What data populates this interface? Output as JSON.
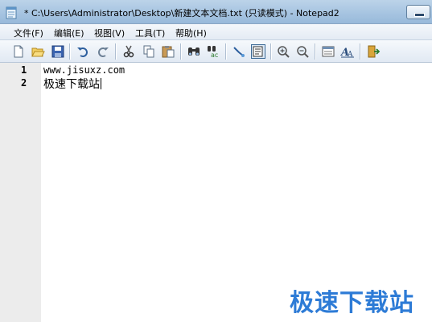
{
  "window": {
    "title": "* C:\\Users\\Administrator\\Desktop\\新建文本文档.txt (只读模式) - Notepad2"
  },
  "menu": {
    "items": [
      "文件(F)",
      "编辑(E)",
      "视图(V)",
      "工具(T)",
      "帮助(H)"
    ]
  },
  "toolbar": {
    "buttons": [
      "new-file-icon",
      "open-folder-icon",
      "save-icon",
      "undo-icon",
      "redo-icon",
      "cut-icon",
      "copy-icon",
      "paste-icon",
      "find-icon",
      "replace-icon",
      "word-wrap-icon",
      "view-whitespace-icon",
      "zoom-in-icon",
      "zoom-out-icon",
      "scheme-icon",
      "font-icon",
      "exit-icon"
    ],
    "active_button": "view-whitespace-icon"
  },
  "editor": {
    "lines": [
      {
        "number": "1",
        "text": "www.jisuxz.com"
      },
      {
        "number": "2",
        "text": "极速下载站"
      }
    ]
  },
  "watermark": {
    "text": "极速下载站",
    "color": "#2d7bd6"
  }
}
